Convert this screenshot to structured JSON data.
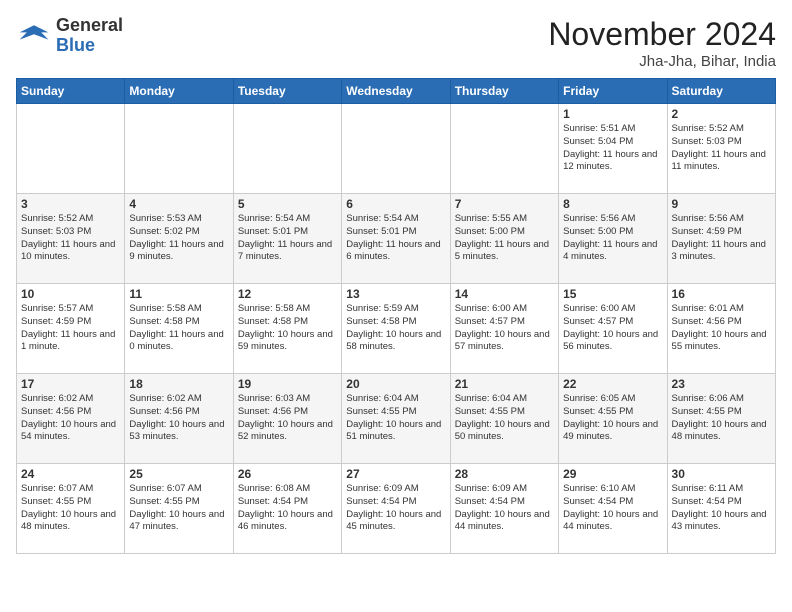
{
  "header": {
    "logo_general": "General",
    "logo_blue": "Blue",
    "title": "November 2024",
    "location": "Jha-Jha, Bihar, India"
  },
  "days_of_week": [
    "Sunday",
    "Monday",
    "Tuesday",
    "Wednesday",
    "Thursday",
    "Friday",
    "Saturday"
  ],
  "weeks": [
    [
      {
        "day": "",
        "content": ""
      },
      {
        "day": "",
        "content": ""
      },
      {
        "day": "",
        "content": ""
      },
      {
        "day": "",
        "content": ""
      },
      {
        "day": "",
        "content": ""
      },
      {
        "day": "1",
        "content": "Sunrise: 5:51 AM\nSunset: 5:04 PM\nDaylight: 11 hours\nand 12 minutes."
      },
      {
        "day": "2",
        "content": "Sunrise: 5:52 AM\nSunset: 5:03 PM\nDaylight: 11 hours\nand 11 minutes."
      }
    ],
    [
      {
        "day": "3",
        "content": "Sunrise: 5:52 AM\nSunset: 5:03 PM\nDaylight: 11 hours\nand 10 minutes."
      },
      {
        "day": "4",
        "content": "Sunrise: 5:53 AM\nSunset: 5:02 PM\nDaylight: 11 hours\nand 9 minutes."
      },
      {
        "day": "5",
        "content": "Sunrise: 5:54 AM\nSunset: 5:01 PM\nDaylight: 11 hours\nand 7 minutes."
      },
      {
        "day": "6",
        "content": "Sunrise: 5:54 AM\nSunset: 5:01 PM\nDaylight: 11 hours\nand 6 minutes."
      },
      {
        "day": "7",
        "content": "Sunrise: 5:55 AM\nSunset: 5:00 PM\nDaylight: 11 hours\nand 5 minutes."
      },
      {
        "day": "8",
        "content": "Sunrise: 5:56 AM\nSunset: 5:00 PM\nDaylight: 11 hours\nand 4 minutes."
      },
      {
        "day": "9",
        "content": "Sunrise: 5:56 AM\nSunset: 4:59 PM\nDaylight: 11 hours\nand 3 minutes."
      }
    ],
    [
      {
        "day": "10",
        "content": "Sunrise: 5:57 AM\nSunset: 4:59 PM\nDaylight: 11 hours\nand 1 minute."
      },
      {
        "day": "11",
        "content": "Sunrise: 5:58 AM\nSunset: 4:58 PM\nDaylight: 11 hours\nand 0 minutes."
      },
      {
        "day": "12",
        "content": "Sunrise: 5:58 AM\nSunset: 4:58 PM\nDaylight: 10 hours\nand 59 minutes."
      },
      {
        "day": "13",
        "content": "Sunrise: 5:59 AM\nSunset: 4:58 PM\nDaylight: 10 hours\nand 58 minutes."
      },
      {
        "day": "14",
        "content": "Sunrise: 6:00 AM\nSunset: 4:57 PM\nDaylight: 10 hours\nand 57 minutes."
      },
      {
        "day": "15",
        "content": "Sunrise: 6:00 AM\nSunset: 4:57 PM\nDaylight: 10 hours\nand 56 minutes."
      },
      {
        "day": "16",
        "content": "Sunrise: 6:01 AM\nSunset: 4:56 PM\nDaylight: 10 hours\nand 55 minutes."
      }
    ],
    [
      {
        "day": "17",
        "content": "Sunrise: 6:02 AM\nSunset: 4:56 PM\nDaylight: 10 hours\nand 54 minutes."
      },
      {
        "day": "18",
        "content": "Sunrise: 6:02 AM\nSunset: 4:56 PM\nDaylight: 10 hours\nand 53 minutes."
      },
      {
        "day": "19",
        "content": "Sunrise: 6:03 AM\nSunset: 4:56 PM\nDaylight: 10 hours\nand 52 minutes."
      },
      {
        "day": "20",
        "content": "Sunrise: 6:04 AM\nSunset: 4:55 PM\nDaylight: 10 hours\nand 51 minutes."
      },
      {
        "day": "21",
        "content": "Sunrise: 6:04 AM\nSunset: 4:55 PM\nDaylight: 10 hours\nand 50 minutes."
      },
      {
        "day": "22",
        "content": "Sunrise: 6:05 AM\nSunset: 4:55 PM\nDaylight: 10 hours\nand 49 minutes."
      },
      {
        "day": "23",
        "content": "Sunrise: 6:06 AM\nSunset: 4:55 PM\nDaylight: 10 hours\nand 48 minutes."
      }
    ],
    [
      {
        "day": "24",
        "content": "Sunrise: 6:07 AM\nSunset: 4:55 PM\nDaylight: 10 hours\nand 48 minutes."
      },
      {
        "day": "25",
        "content": "Sunrise: 6:07 AM\nSunset: 4:55 PM\nDaylight: 10 hours\nand 47 minutes."
      },
      {
        "day": "26",
        "content": "Sunrise: 6:08 AM\nSunset: 4:54 PM\nDaylight: 10 hours\nand 46 minutes."
      },
      {
        "day": "27",
        "content": "Sunrise: 6:09 AM\nSunset: 4:54 PM\nDaylight: 10 hours\nand 45 minutes."
      },
      {
        "day": "28",
        "content": "Sunrise: 6:09 AM\nSunset: 4:54 PM\nDaylight: 10 hours\nand 44 minutes."
      },
      {
        "day": "29",
        "content": "Sunrise: 6:10 AM\nSunset: 4:54 PM\nDaylight: 10 hours\nand 44 minutes."
      },
      {
        "day": "30",
        "content": "Sunrise: 6:11 AM\nSunset: 4:54 PM\nDaylight: 10 hours\nand 43 minutes."
      }
    ]
  ]
}
